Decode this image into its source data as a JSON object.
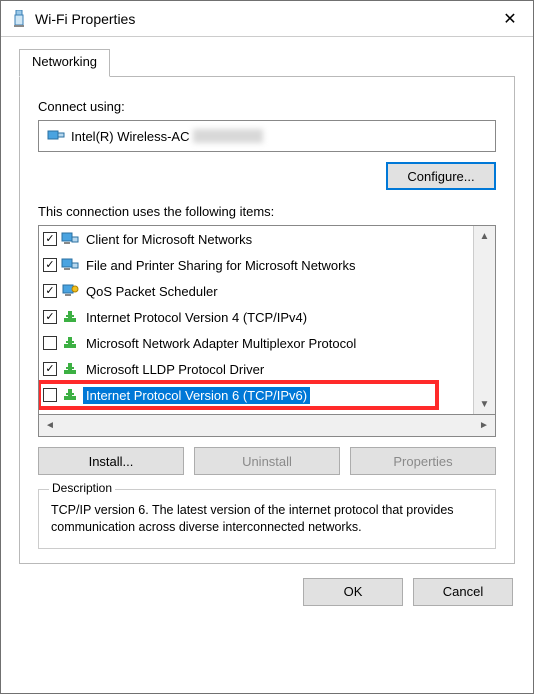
{
  "title": "Wi-Fi Properties",
  "tab_label": "Networking",
  "connect_label": "Connect using:",
  "adapter_name": "Intel(R) Wireless-AC",
  "configure_label": "Configure...",
  "items_label": "This connection uses the following items:",
  "items": [
    {
      "checked": true,
      "icon": "net-client",
      "label": "Client for Microsoft Networks"
    },
    {
      "checked": true,
      "icon": "net-share",
      "label": "File and Printer Sharing for Microsoft Networks"
    },
    {
      "checked": true,
      "icon": "net-sched",
      "label": "QoS Packet Scheduler"
    },
    {
      "checked": true,
      "icon": "net-proto",
      "label": "Internet Protocol Version 4 (TCP/IPv4)"
    },
    {
      "checked": false,
      "icon": "net-proto",
      "label": "Microsoft Network Adapter Multiplexor Protocol"
    },
    {
      "checked": true,
      "icon": "net-proto",
      "label": "Microsoft LLDP Protocol Driver"
    },
    {
      "checked": false,
      "icon": "net-proto",
      "label": "Internet Protocol Version 6 (TCP/IPv6)",
      "selected": true,
      "highlighted": true
    }
  ],
  "install_label": "Install...",
  "uninstall_label": "Uninstall",
  "properties_label": "Properties",
  "description_heading": "Description",
  "description_text": "TCP/IP version 6. The latest version of the internet protocol that provides communication across diverse interconnected networks.",
  "ok_label": "OK",
  "cancel_label": "Cancel"
}
